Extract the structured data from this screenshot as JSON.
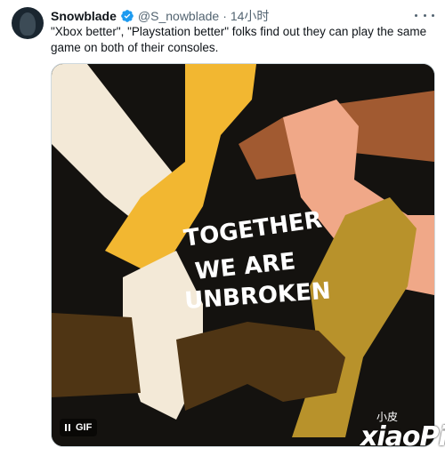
{
  "tweet": {
    "display_name": "Snowblade",
    "handle": "@S_nowblade",
    "separator": "·",
    "time": "14小时",
    "text": "\"Xbox better\", \"Playstation better\" folks find out they can play the same game on both of their consoles."
  },
  "media": {
    "type": "GIF",
    "badge_label": "GIF",
    "art_lines": [
      "TOGETHER",
      "WE ARE",
      "UNBROKEN"
    ],
    "background_color": "#14120f"
  },
  "watermark": {
    "top": "小皮",
    "main": "xiaoPi"
  },
  "colors": {
    "name": "#0f1419",
    "secondary": "#536471",
    "verified": "#1d9bf0"
  }
}
